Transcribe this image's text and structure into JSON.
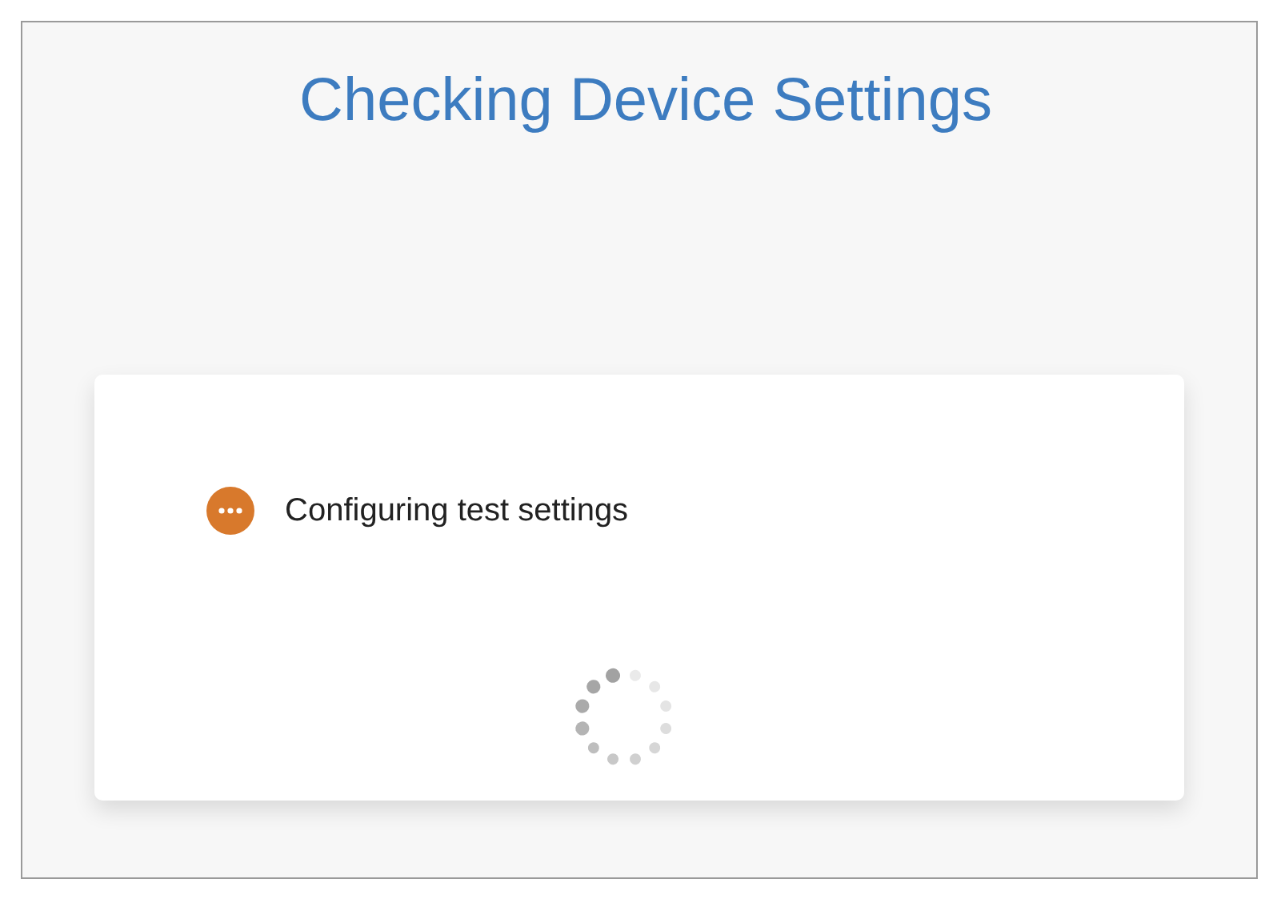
{
  "title": "Checking Device Settings",
  "steps": [
    {
      "label": "Configuring test settings",
      "in_progress": true
    }
  ]
}
